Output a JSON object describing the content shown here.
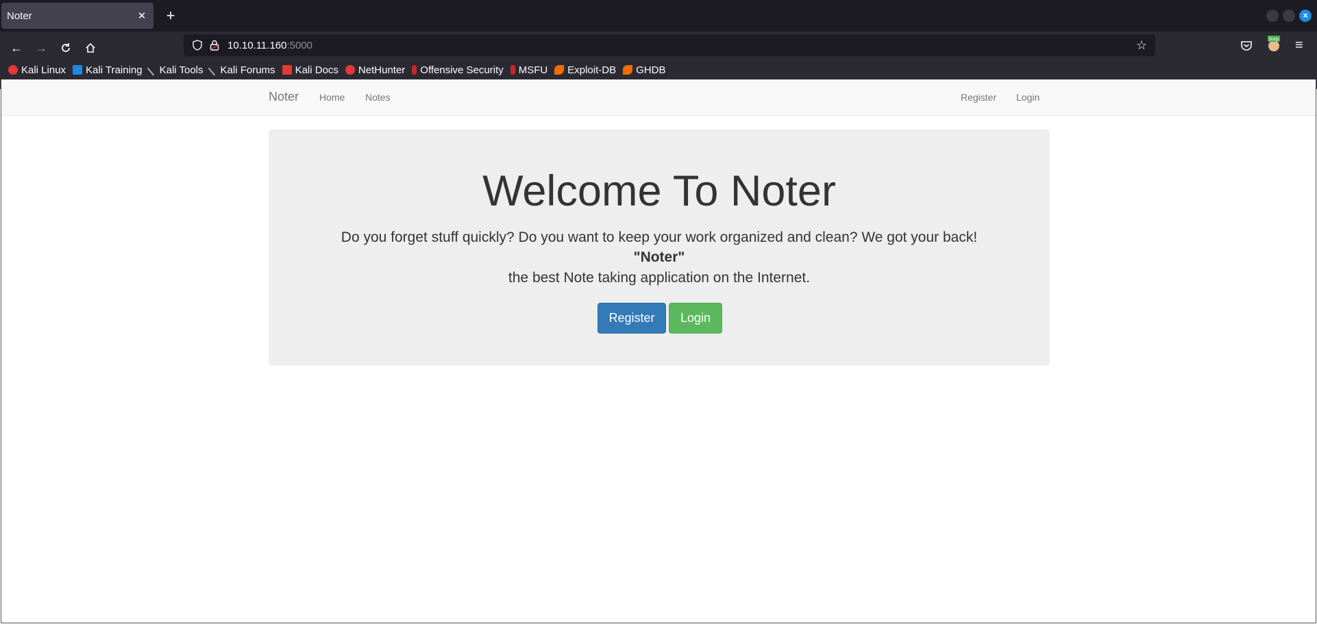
{
  "browser": {
    "tab_title": "Noter",
    "tab_close": "✕",
    "new_tab": "+",
    "url_host": "10.10.11.160",
    "url_port": ":5000",
    "bookmarks": [
      {
        "label": "Kali Linux",
        "icon_color": "#e53935"
      },
      {
        "label": "Kali Training",
        "icon_color": "#1e88e5"
      },
      {
        "label": "Kali Tools",
        "icon_color": "#222222"
      },
      {
        "label": "Kali Forums",
        "icon_color": "#222222"
      },
      {
        "label": "Kali Docs",
        "icon_color": "#e53935"
      },
      {
        "label": "NetHunter",
        "icon_color": "#e53935"
      },
      {
        "label": "Offensive Security",
        "icon_color": "#c62828"
      },
      {
        "label": "MSFU",
        "icon_color": "#c62828"
      },
      {
        "label": "Exploit-DB",
        "icon_color": "#ef6c00"
      },
      {
        "label": "GHDB",
        "icon_color": "#ef6c00"
      }
    ],
    "extension_badge": "burp"
  },
  "site": {
    "brand": "Noter",
    "nav": {
      "home": "Home",
      "notes": "Notes",
      "register": "Register",
      "login": "Login"
    },
    "hero": {
      "title": "Welcome To Noter",
      "line1": "Do you forget stuff quickly? Do you want to keep your work organized and clean? We got your back!",
      "brand_line": "\"Noter\"",
      "line3": "the best Note taking application on the Internet.",
      "register_button": "Register",
      "login_button": "Login"
    }
  },
  "colors": {
    "register_button": "#337ab7",
    "login_button": "#5cb85c"
  }
}
